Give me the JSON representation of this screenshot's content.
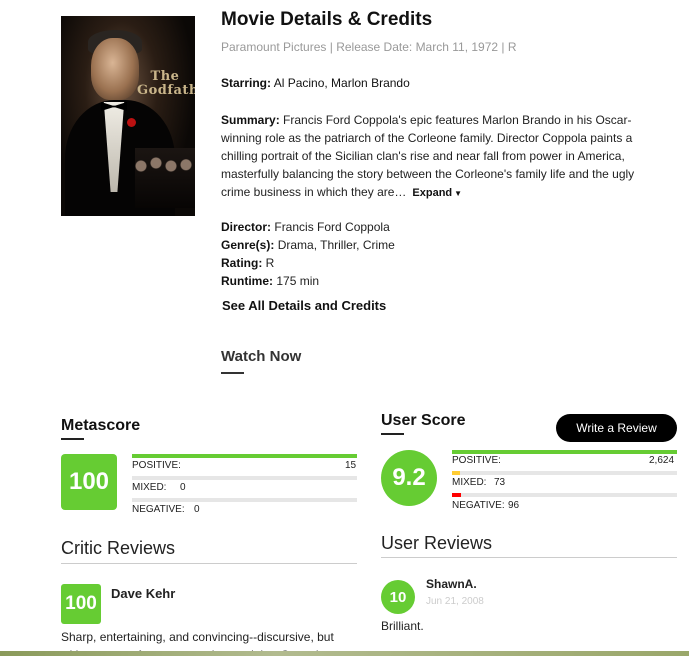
{
  "movie": {
    "title": "Movie Details & Credits",
    "studio": "Paramount Pictures",
    "release": "Release Date: March 11, 1972",
    "rating_meta": "R",
    "starring_label": "Starring:",
    "starring": "Al Pacino, Marlon Brando",
    "summary_label": "Summary:",
    "summary": "Francis Ford Coppola's epic features Marlon Brando in his Oscar-winning role as the patriarch of the Corleone family. Director Coppola paints a chilling portrait of the Sicilian clan's rise and near fall from power in America, masterfully balancing the story between the Corleone's family life and the ugly crime business in which they are…",
    "expand_label": "Expand",
    "poster_logo": "The Godfather",
    "director_label": "Director:",
    "director": "Francis Ford Coppola",
    "genres_label": "Genre(s):",
    "genres": "Drama, Thriller, Crime",
    "rating_label": "Rating:",
    "rating": "R",
    "runtime_label": "Runtime:",
    "runtime": "175 min",
    "see_all": "See All Details and Credits",
    "watch_now": "Watch Now"
  },
  "metascore": {
    "heading": "Metascore",
    "score": "100",
    "positive_label": "POSITIVE:",
    "positive": "15",
    "mixed_label": "MIXED:",
    "mixed": "0",
    "negative_label": "NEGATIVE:",
    "negative": "0",
    "positive_fraction": 1.0,
    "mixed_fraction": 0.0,
    "negative_fraction": 0.0
  },
  "userscore": {
    "heading": "User Score",
    "write_review": "Write a Review",
    "score": "9.2",
    "positive_label": "POSITIVE:",
    "positive": "2,624",
    "mixed_label": "MIXED:",
    "mixed": "73",
    "negative_label": "NEGATIVE:",
    "negative": "96",
    "positive_fraction": 1.0,
    "mixed_fraction": 0.03,
    "negative_fraction": 0.04
  },
  "critic_reviews": {
    "heading": "Critic Reviews",
    "items": [
      {
        "score": "100",
        "name": "Dave Kehr",
        "text": "Sharp, entertaining, and convincing--discursive, but with a sense of structure and control that Coppola"
      }
    ]
  },
  "user_reviews": {
    "heading": "User Reviews",
    "items": [
      {
        "score": "10",
        "name": "ShawnA.",
        "date": "Jun 21, 2008",
        "text": "Brilliant."
      }
    ]
  },
  "colors": {
    "score_green": "#66cc33",
    "mixed_yellow": "#ffcc33",
    "negative_red": "#ff0000"
  }
}
